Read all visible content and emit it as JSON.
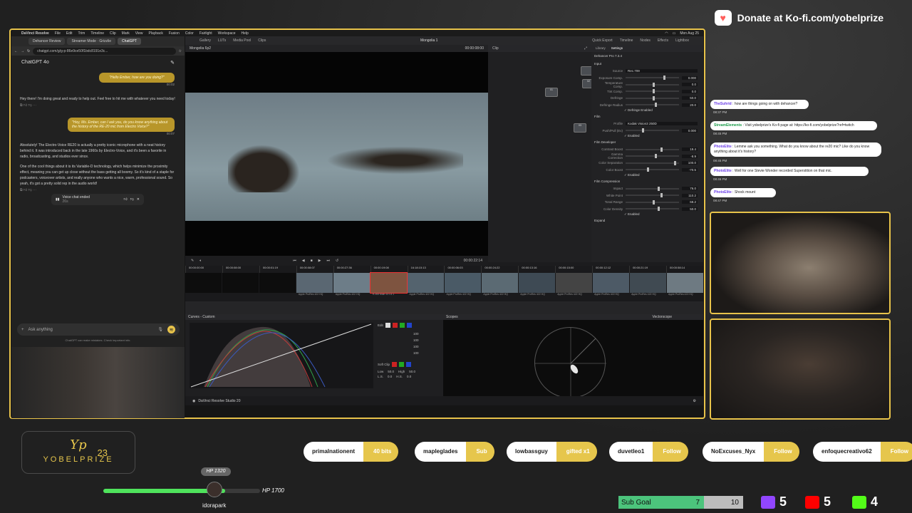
{
  "donate": {
    "text": "Donate at Ko-fi.com/yobelprize"
  },
  "mac_menu": {
    "items": [
      "DaVinci Resolve",
      "File",
      "Edit",
      "Trim",
      "Timeline",
      "Clip",
      "Mark",
      "View",
      "Playback",
      "Fusion",
      "Color",
      "Fairlight",
      "Workspace",
      "Help"
    ],
    "clock": "Mon Aug 25"
  },
  "browser": {
    "tabs": [
      "Dehancer Review",
      "Streamer Mode · Grizzlie",
      "ChatGPT"
    ],
    "url": "chatgpt.com/g/g-p-86e9ce50f1bdc8191e3c...",
    "gpt_title": "ChatGPT 4o",
    "messages": [
      {
        "role": "user",
        "text": "\"Hello Ember, how are you doing?\"",
        "time": "00:02"
      },
      {
        "role": "assistant",
        "text": "Hey there! I'm doing great and ready to help out. Feel free to hit me with whatever you need today!"
      },
      {
        "role": "user",
        "text": "\"Hey, Ms. Ember, can I ask you, do you know anything about the history of the RE-20 mic from Electro Voice?\"",
        "time": "00:07"
      },
      {
        "role": "assistant",
        "text": "Absolutely! The Electro-Voice RE20 is actually a pretty iconic microphone with a neat history behind it. It was introduced back in the late 1960s by Electro-Voice, and it's been a favorite in radio, broadcasting, and studios ever since."
      },
      {
        "role": "assistant",
        "text": "One of the cool things about it is its Variable-D technology, which helps minimize the proximity effect, meaning you can get up close without the bass getting all boomy. So it's kind of a staple for podcasters, voiceover artists, and really anyone who wants a nice, warm, professional sound. So yeah, it's got a pretty solid rep in the audio world!"
      }
    ],
    "voice_chat": {
      "label": "Voice chat ended",
      "duration": "26s"
    },
    "input_placeholder": "Ask anything",
    "disclaimer": "ChatGPT can make mistakes. Check important info."
  },
  "resolve": {
    "title": "Mongolia 1",
    "toolbar": [
      "Gallery",
      "LUTs",
      "Media Pool",
      "Clips",
      "Quick Export",
      "Timeline",
      "Nodes",
      "Effects",
      "Lightbox"
    ],
    "timeline_name": "Mongolia 6p2",
    "viewer_tc": "00:00:08:00",
    "transport_tc": "00:00:22:14",
    "clip_label": "Clip",
    "fx_tabs": [
      "Library",
      "Settings"
    ],
    "fx_title": "Dehancer Pro 7.3.4",
    "fx_sections": [
      {
        "name": "Input",
        "rows": [
          {
            "label": "Source",
            "value": "Rec.709"
          },
          {
            "label": "Exposure Comp.",
            "value": "0.000"
          },
          {
            "label": "Temperature Comp.",
            "value": "0.0"
          },
          {
            "label": "Tint Comp.",
            "value": "0.0"
          },
          {
            "label": "Defringe",
            "value": "50.0"
          },
          {
            "label": "Defringe Radius",
            "value": "20.0"
          }
        ],
        "check": "Defringe Enabled"
      },
      {
        "name": "Film",
        "rows": [
          {
            "label": "Profile",
            "value": "Kodak Vision3 250D"
          },
          {
            "label": "Push/Pull (Ev)",
            "value": "0.000"
          }
        ],
        "check": "Enabled"
      },
      {
        "name": "Film Developer",
        "rows": [
          {
            "label": "Contrast Boost",
            "value": "19.4"
          },
          {
            "label": "Gamma Correction",
            "value": "-8.9"
          },
          {
            "label": "Color Separation",
            "value": "100.0"
          },
          {
            "label": "Color Boost",
            "value": "-70.5"
          }
        ],
        "check": "Enabled"
      },
      {
        "name": "Film Compression",
        "rows": [
          {
            "label": "Impact",
            "value": "76.0"
          },
          {
            "label": "White Point",
            "value": "110.2"
          },
          {
            "label": "Tonal Range",
            "value": "68.2"
          },
          {
            "label": "Color Density",
            "value": "50.0"
          }
        ],
        "check": "Enabled"
      }
    ],
    "fx_expand": "Expand",
    "timecodes": [
      "00:00:00:00",
      "00:00:08:00",
      "00:00:01:19",
      "00:00:08:07",
      "00:00:27:36",
      "00:00:19:08",
      "16:18:15:13",
      "00:00:06:03",
      "00:00:24:22",
      "00:00:13:16",
      "00:00:15:00",
      "00:00:12:12",
      "00:00:21:19",
      "00:00:58:14",
      "00:00:02:00"
    ],
    "clip_names": [
      "",
      "",
      "",
      "Apple ProRes 422 HQ",
      "Apple ProRes 422 HQ",
      "H.265 Main 10 L5.1",
      "Apple ProRes 422 HQ",
      "Apple ProRes 422 HQ",
      "Apple ProRes 422 HQ",
      "Apple ProRes 422 HQ",
      "Apple ProRes 422 HQ",
      "Apple ProRes 422 HQ",
      "Apple ProRes 422 HQ",
      "Apple ProRes 422 HQ"
    ],
    "curves_title": "Curves - Custom",
    "curves_edit": "Edit",
    "curves_values": [
      "100",
      "100",
      "100",
      "100"
    ],
    "soft_clip": "Soft Clip",
    "soft_clip_rows": [
      {
        "label": "Low",
        "a": "50.0",
        "b": "High",
        "c": "50.0"
      },
      {
        "label": "L.S.",
        "a": "0.0",
        "b": "H.S.",
        "c": "0.0"
      }
    ],
    "scopes_title": "Scopes",
    "scope_type": "Vectorscope",
    "footer": "DaVinci Resolve Studio 20"
  },
  "chat": [
    {
      "user": "TheSuhrid",
      "text": "how are things going on with dehancer?",
      "time": "08:37 PM"
    },
    {
      "user": "StreamElements",
      "text": "Visit yobelprize's Ko-fi page at: https://ko-fi.com/yobelprize?ref=twitch",
      "time": "08:45 PM"
    },
    {
      "user": "PhotoElite",
      "text": "Lemme ask you something. What do you know about the re20 mic? Like do you know anything about it's history?",
      "time": "08:45 PM"
    },
    {
      "user": "PhotoElite",
      "text": "Well for one Stevie Wonder recorded Superstition on that mic.",
      "time": "08:46 PM"
    },
    {
      "user": "PhotoElite",
      "text": "Shock mount",
      "time": "08:47 PM"
    }
  ],
  "logo": {
    "name": "YOBELPRIZE",
    "number": "23",
    "mark": "Yp"
  },
  "feed": [
    {
      "name": "primalnationent",
      "action": "40 bits"
    },
    {
      "name": "mapleglades",
      "action": "Sub"
    },
    {
      "name": "lowbassguy",
      "action": "gifted x1"
    },
    {
      "name": "duvetleo1",
      "action": "Follow"
    },
    {
      "name": "NoExcuses_Nyx",
      "action": "Follow"
    },
    {
      "name": "enfoquecreativo62",
      "action": "Follow"
    }
  ],
  "hp": {
    "badge": "HP 1320",
    "label": "HP 1700",
    "user": "idorapark",
    "fraction": 0.7765
  },
  "subgoal": {
    "label": "Sub Goal",
    "current": "7",
    "target": "10"
  },
  "platforms": [
    {
      "name": "twitch",
      "count": "5",
      "color": "#9146ff"
    },
    {
      "name": "youtube",
      "count": "5",
      "color": "#ff0000"
    },
    {
      "name": "kick",
      "count": "4",
      "color": "#53fc18"
    }
  ]
}
